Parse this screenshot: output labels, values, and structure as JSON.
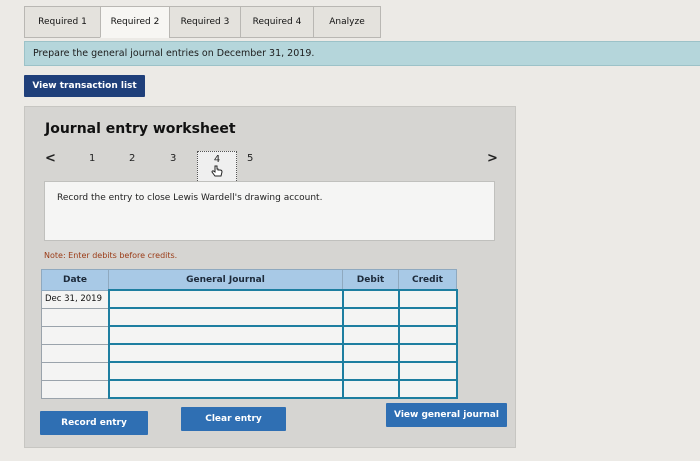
{
  "tabs": [
    {
      "label": "Required 1",
      "active": false
    },
    {
      "label": "Required 2",
      "active": true
    },
    {
      "label": "Required 3",
      "active": false
    },
    {
      "label": "Required 4",
      "active": false
    },
    {
      "label": "Analyze",
      "active": false
    }
  ],
  "instruction": "Prepare the general journal entries on December 31, 2019.",
  "view_transactions_label": "View transaction list",
  "worksheet": {
    "title": "Journal entry worksheet",
    "pages": [
      "1",
      "2",
      "3",
      "4",
      "5"
    ],
    "prev_symbol": "<",
    "next_symbol": ">",
    "record_text": "Record the entry to close Lewis Wardell's drawing account.",
    "note": "Note: Enter debits before credits.",
    "columns": [
      "Date",
      "General Journal",
      "Debit",
      "Credit"
    ],
    "rows": [
      {
        "date": "Dec 31, 2019",
        "account": "",
        "debit": "",
        "credit": ""
      },
      {
        "date": "",
        "account": "",
        "debit": "",
        "credit": ""
      },
      {
        "date": "",
        "account": "",
        "debit": "",
        "credit": ""
      },
      {
        "date": "",
        "account": "",
        "debit": "",
        "credit": ""
      },
      {
        "date": "",
        "account": "",
        "debit": "",
        "credit": ""
      },
      {
        "date": "",
        "account": "",
        "debit": "",
        "credit": ""
      }
    ]
  },
  "buttons": {
    "record": "Record entry",
    "clear": "Clear entry",
    "view_journal": "View general journal"
  }
}
